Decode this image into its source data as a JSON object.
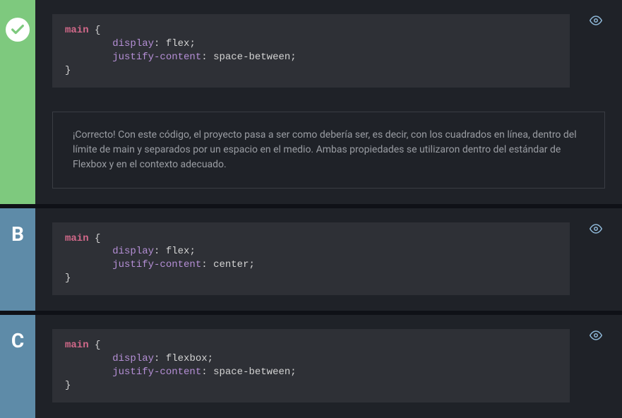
{
  "options": [
    {
      "id": "A",
      "correct": true,
      "code": {
        "selector": "main",
        "properties": [
          {
            "name": "display",
            "value": "flex"
          },
          {
            "name": "justify-content",
            "value": "space-between"
          }
        ]
      },
      "explanation": "¡Correcto! Con este código, el proyecto pasa a ser como debería ser, es decir, con los cuadrados en línea, dentro del límite de main y separados por un espacio en el medio. Ambas propiedades se utilizaron dentro del estándar de Flexbox y en el contexto adecuado."
    },
    {
      "id": "B",
      "correct": false,
      "code": {
        "selector": "main",
        "properties": [
          {
            "name": "display",
            "value": "flex"
          },
          {
            "name": "justify-content",
            "value": "center"
          }
        ]
      }
    },
    {
      "id": "C",
      "correct": false,
      "code": {
        "selector": "main",
        "properties": [
          {
            "name": "display",
            "value": "flexbox"
          },
          {
            "name": "justify-content",
            "value": "space-between"
          }
        ]
      }
    }
  ]
}
